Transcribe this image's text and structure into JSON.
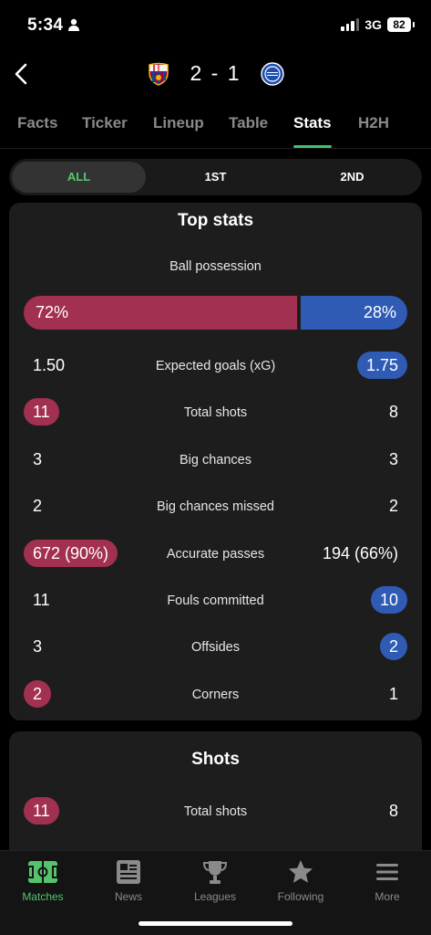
{
  "status_bar": {
    "time": "5:34",
    "network": "3G",
    "battery": "82"
  },
  "match": {
    "home_crest": "barcelona-crest",
    "away_crest": "alaves-crest",
    "score": "2 - 1"
  },
  "tabs": [
    {
      "label": "Facts"
    },
    {
      "label": "Ticker"
    },
    {
      "label": "Lineup"
    },
    {
      "label": "Table"
    },
    {
      "label": "Stats",
      "active": true
    },
    {
      "label": "H2H"
    }
  ],
  "period": {
    "options": [
      "ALL",
      "1ST",
      "2ND"
    ],
    "selected": "ALL"
  },
  "top_stats": {
    "title": "Top stats",
    "possession": {
      "label": "Ball possession",
      "home": "72%",
      "away": "28%",
      "home_fraction": 0.72
    },
    "rows": [
      {
        "label": "Expected goals (xG)",
        "home": "1.50",
        "away": "1.75"
      },
      {
        "label": "Total shots",
        "home": "11",
        "away": "8"
      },
      {
        "label": "Big chances",
        "home": "3",
        "away": "3"
      },
      {
        "label": "Big chances missed",
        "home": "2",
        "away": "2"
      },
      {
        "label": "Accurate passes",
        "home": "672 (90%)",
        "away": "194 (66%)"
      },
      {
        "label": "Fouls committed",
        "home": "11",
        "away": "10"
      },
      {
        "label": "Offsides",
        "home": "3",
        "away": "2"
      },
      {
        "label": "Corners",
        "home": "2",
        "away": "1"
      }
    ]
  },
  "shots": {
    "title": "Shots",
    "rows": [
      {
        "label": "Total shots",
        "home": "11",
        "away": "8"
      }
    ]
  },
  "colors": {
    "home": "#a23050",
    "away": "#2f5bb5",
    "accent": "#42c26a"
  },
  "bottom_nav": [
    {
      "label": "Matches",
      "icon": "pitch-icon",
      "active": true
    },
    {
      "label": "News",
      "icon": "news-icon"
    },
    {
      "label": "Leagues",
      "icon": "trophy-icon"
    },
    {
      "label": "Following",
      "icon": "star-icon"
    },
    {
      "label": "More",
      "icon": "menu-icon"
    }
  ]
}
